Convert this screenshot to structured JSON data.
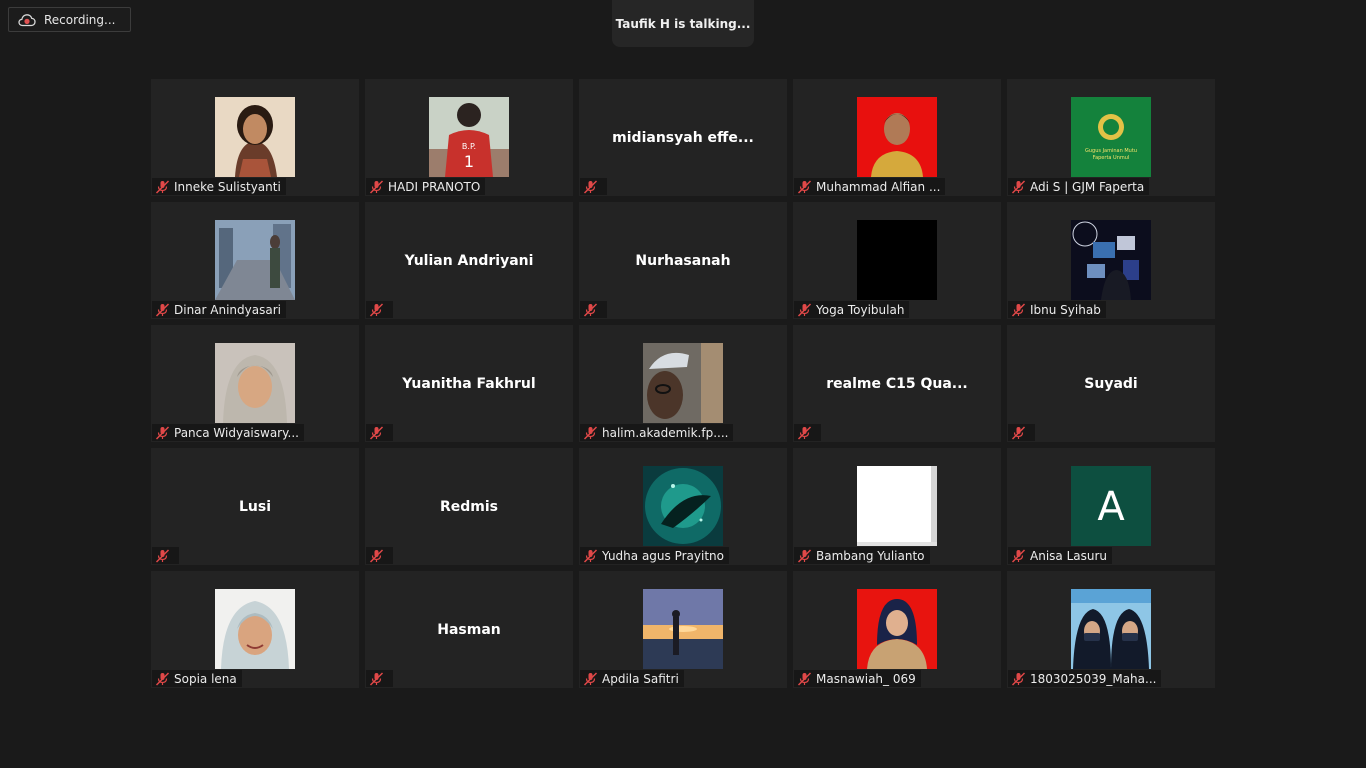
{
  "recording": {
    "label": "Recording..."
  },
  "active_speaker": {
    "text": "Taufik H is talking..."
  },
  "participants": [
    {
      "name": "Inneke Sulistyanti",
      "tile_title": ""
    },
    {
      "name": "HADI PRANOTO",
      "tile_title": ""
    },
    {
      "name": "",
      "tile_title": "midiansyah  effe..."
    },
    {
      "name": "Muhammad Alfian ...",
      "tile_title": ""
    },
    {
      "name": "Adi S | GJM Faperta",
      "tile_title": ""
    },
    {
      "name": "Dinar Anindyasari",
      "tile_title": ""
    },
    {
      "name": "",
      "tile_title": "Yulian Andriyani"
    },
    {
      "name": "",
      "tile_title": "Nurhasanah"
    },
    {
      "name": "Yoga Toyibulah",
      "tile_title": ""
    },
    {
      "name": "Ibnu Syihab",
      "tile_title": ""
    },
    {
      "name": "Panca Widyaiswary...",
      "tile_title": ""
    },
    {
      "name": "",
      "tile_title": "Yuanitha Fakhrul"
    },
    {
      "name": "halim.akademik.fp....",
      "tile_title": ""
    },
    {
      "name": "",
      "tile_title": "realme  C15  Qua..."
    },
    {
      "name": "",
      "tile_title": "Suyadi"
    },
    {
      "name": "",
      "tile_title": "Lusi"
    },
    {
      "name": "",
      "tile_title": "Redmis"
    },
    {
      "name": "Yudha agus Prayitno",
      "tile_title": ""
    },
    {
      "name": "Bambang Yulianto",
      "tile_title": ""
    },
    {
      "name": "Anisa Lasuru",
      "tile_title": ""
    },
    {
      "name": "Sopia lena",
      "tile_title": ""
    },
    {
      "name": "",
      "tile_title": "Hasman"
    },
    {
      "name": "Apdila Safitri",
      "tile_title": ""
    },
    {
      "name": "Masnawiah_ 069",
      "tile_title": ""
    },
    {
      "name": "1803025039_Maha...",
      "tile_title": ""
    }
  ],
  "avatars": {
    "gjm_logo_line1": "Gugus Jaminan Mutu",
    "gjm_logo_line2": "Faperta Unmul",
    "anisa_letter": "A"
  },
  "colors": {
    "background": "#1a1a1a",
    "tile": "#232323",
    "mute": "#e04848",
    "recording_icon": "#e05252",
    "gjm_green": "#14823c",
    "anisa_bg": "#0d4f40"
  }
}
